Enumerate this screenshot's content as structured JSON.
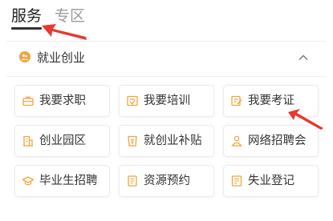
{
  "tabs": [
    {
      "label": "服务",
      "active": true
    },
    {
      "label": "专区",
      "active": false
    }
  ],
  "section": {
    "title": "就业创业",
    "icon": "people-icon",
    "collapse_icon": "chevron-up-icon",
    "accent": "#F2A53A"
  },
  "services": [
    {
      "label": "我要求职",
      "icon": "briefcase-icon"
    },
    {
      "label": "我要培训",
      "icon": "training-icon"
    },
    {
      "label": "我要考证",
      "icon": "certificate-icon"
    },
    {
      "label": "创业园区",
      "icon": "building-icon"
    },
    {
      "label": "就创业补贴",
      "icon": "subsidy-icon"
    },
    {
      "label": "网络招聘会",
      "icon": "person-icon"
    },
    {
      "label": "毕业生招聘",
      "icon": "graduation-cap-icon"
    },
    {
      "label": "资源预约",
      "icon": "document-icon"
    },
    {
      "label": "失业登记",
      "icon": "register-icon"
    }
  ],
  "colors": {
    "icon": "#F2A53A",
    "annotation_arrow": "#E8382F"
  }
}
